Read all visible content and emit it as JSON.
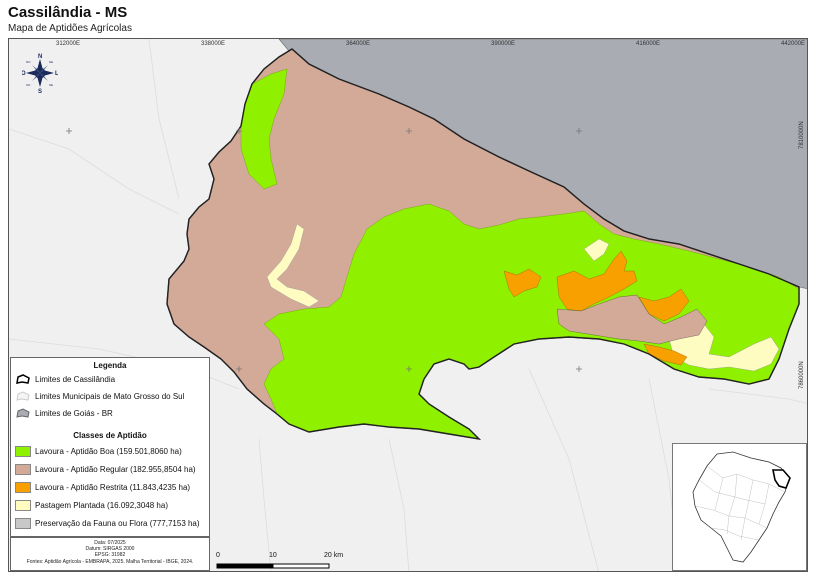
{
  "title": "Cassilândia - MS",
  "subtitle": "Mapa de Aptidões Agrícolas",
  "coords": {
    "x": [
      "312000E",
      "338000E",
      "364000E",
      "390000E",
      "416000E",
      "442000E"
    ],
    "y": [
      "7810000N",
      "7860000N"
    ]
  },
  "compass": {
    "n": "N",
    "s": "S",
    "e": "L",
    "w": "O",
    "ne": "NE",
    "no": "NO",
    "se": "SE",
    "so": "SO"
  },
  "legend": {
    "title": "Legenda",
    "limits": [
      {
        "label": "Limites de Cassilândia"
      },
      {
        "label": "Limites Municipais de Mato Grosso do Sul"
      },
      {
        "label": "Limites de Goiás - BR"
      }
    ],
    "classes_title": "Classes de Aptidão",
    "classes": [
      {
        "label": "Lavoura - Aptidão Boa (159.501,8060 ha)",
        "color": "#8ff000"
      },
      {
        "label": "Lavoura - Aptidão Regular (182.955,8504 ha)",
        "color": "#d3aa98"
      },
      {
        "label": "Lavoura - Aptidão Restrita (11.843,4235 ha)",
        "color": "#f7a000"
      },
      {
        "label": "Pastagem Plantada (16.092,3048 ha)",
        "color": "#fffcc2"
      },
      {
        "label": "Preservação da Fauna ou Flora (777,7153 ha)",
        "color": "#c8c8c8"
      }
    ]
  },
  "meta": {
    "date": "Data: 07/2025",
    "datum": "Datum: SIRGAS 2000",
    "epsg": "EPSG: 31982",
    "sources": "Fontes: Aptidão Agrícola - EMBRAPA, 2025. Malha Territorial - IBGE, 2024."
  },
  "scalebar": {
    "labels": [
      "0",
      "10",
      "20 km"
    ]
  },
  "colors": {
    "goias": "#a9acb3",
    "background": "#f0f0f0",
    "boundary": "#333333"
  }
}
